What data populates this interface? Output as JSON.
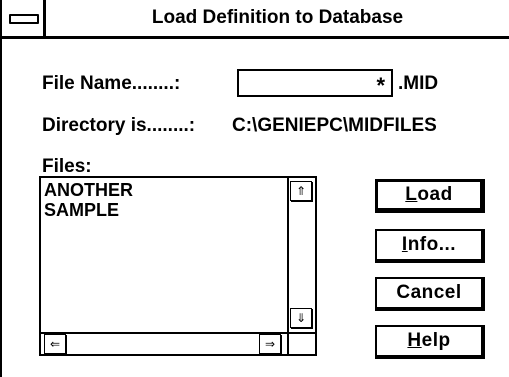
{
  "dialog": {
    "title": "Load Definition to Database"
  },
  "file_name": {
    "label": "File Name........:",
    "value": "*",
    "extension": ".MID"
  },
  "directory": {
    "label": "Directory is........:",
    "path": "C:\\GENIEPC\\MIDFILES"
  },
  "files": {
    "label": "Files:",
    "items": [
      "ANOTHER",
      "SAMPLE"
    ]
  },
  "scroll_glyphs": {
    "up": "⇑",
    "down": "⇓",
    "left": "⇐",
    "right": "⇒"
  },
  "buttons": {
    "load": {
      "accel": "L",
      "rest": "oad"
    },
    "info": {
      "accel": "I",
      "rest": "nfo..."
    },
    "cancel": {
      "label": "Cancel"
    },
    "help": {
      "accel": "H",
      "rest": "elp"
    }
  }
}
